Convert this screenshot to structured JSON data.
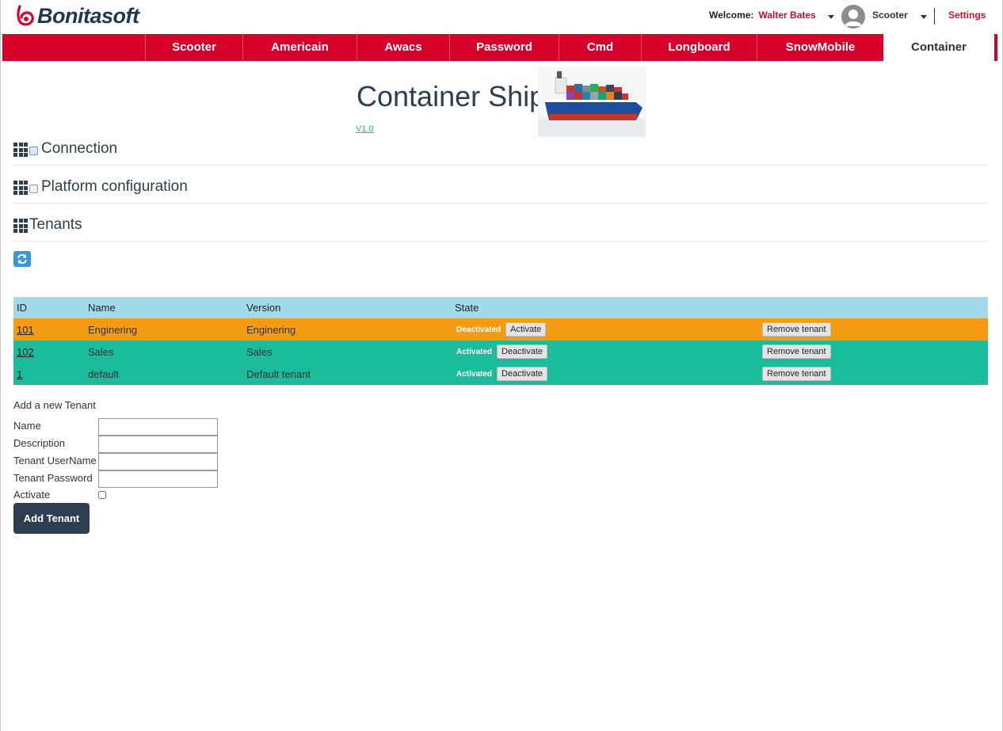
{
  "header": {
    "logo_text": "Bonitasoft",
    "welcome_label": "Welcome:",
    "user_name": "Walter Bates",
    "app_name": "Scooter",
    "settings_label": "Settings",
    "brand_color": "#d6002a"
  },
  "nav": {
    "items": [
      {
        "label": "Scooter",
        "active": false
      },
      {
        "label": "Americain",
        "active": false
      },
      {
        "label": "Awacs",
        "active": false
      },
      {
        "label": "Password",
        "active": false
      },
      {
        "label": "Cmd",
        "active": false
      },
      {
        "label": "Longboard",
        "active": false
      },
      {
        "label": "SnowMobile",
        "active": false
      },
      {
        "label": "Container",
        "active": true
      }
    ]
  },
  "page": {
    "title": "Container Ship",
    "version": "V1.0",
    "image": "container-ship-image"
  },
  "sections": {
    "connection": "Connection",
    "platform": "Platform configuration",
    "tenants": "Tenants"
  },
  "table": {
    "headers": [
      "ID",
      "Name",
      "Version",
      "State",
      ""
    ],
    "rows": [
      {
        "id": "101",
        "name": "Enginering",
        "version": "Enginering",
        "state": "Deactivated",
        "toggle_label": "Activate",
        "remove_label": "Remove tenant"
      },
      {
        "id": "102",
        "name": "Sales",
        "version": "Sales",
        "state": "Activated",
        "toggle_label": "Deactivate",
        "remove_label": "Remove tenant"
      },
      {
        "id": "1",
        "name": "default",
        "version": "Default tenant",
        "state": "Activated",
        "toggle_label": "Deactivate",
        "remove_label": "Remove tenant"
      }
    ],
    "colors": {
      "header": "#a1dbea",
      "deactivated": "#f39c12",
      "activated": "#1abc9c"
    }
  },
  "form": {
    "title": "Add a new Tenant",
    "name_label": "Name",
    "name_value": "",
    "description_label": "Description",
    "description_value": "",
    "username_label": "Tenant UserName",
    "username_value": "",
    "password_label": "Tenant Password",
    "password_value": "",
    "activate_label": "Activate",
    "activate_checked": false,
    "submit_label": "Add Tenant"
  }
}
